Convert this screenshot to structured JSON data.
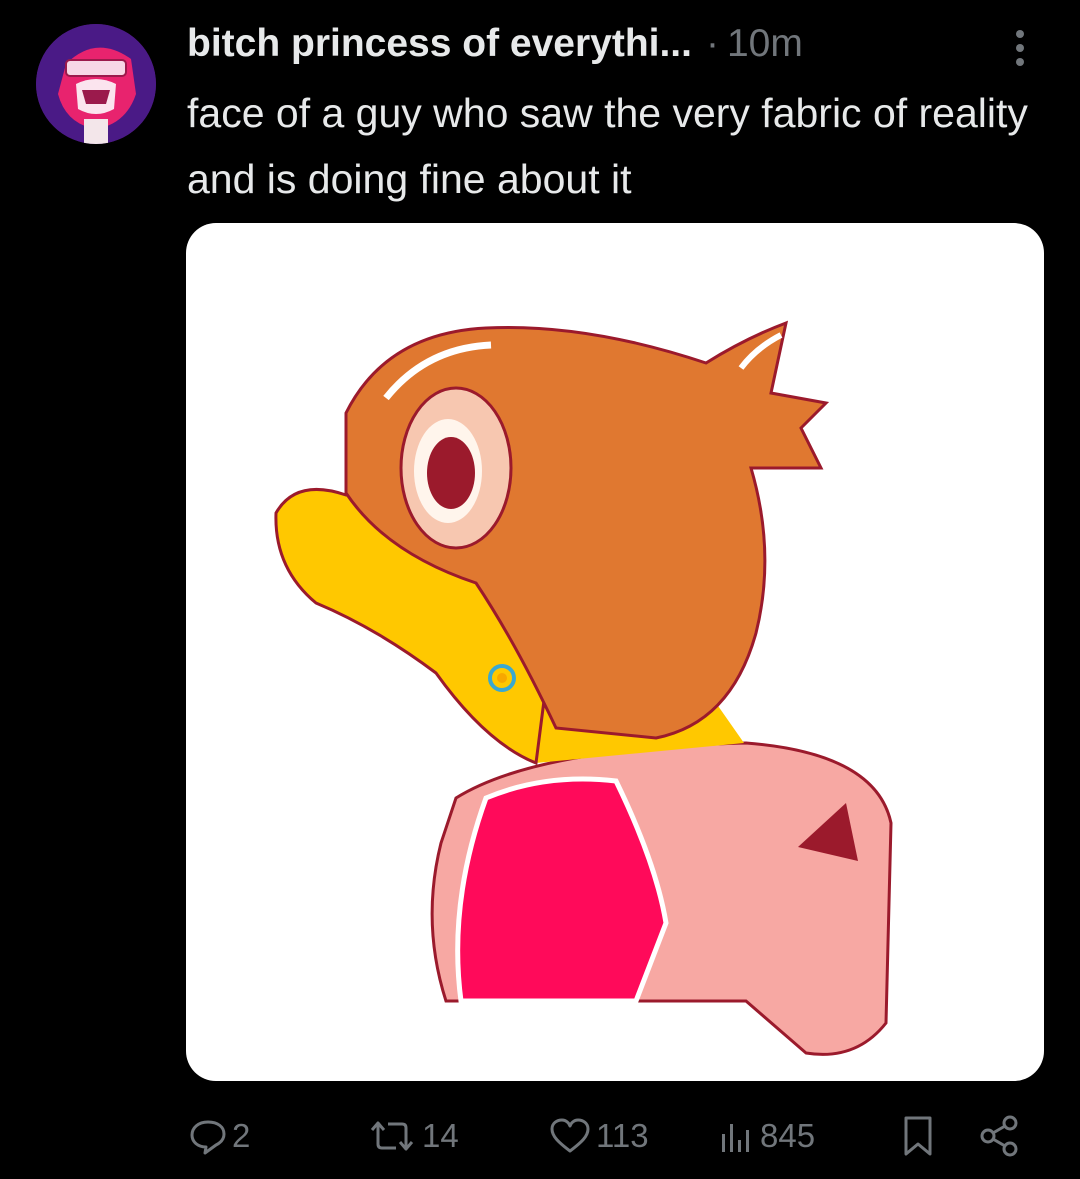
{
  "post": {
    "author_name": "bitch princess of everythi...",
    "separator": "·",
    "time": "10m",
    "text": "face of a guy who saw the very fabric of reality and is doing fine about it"
  },
  "actions": {
    "replies": "2",
    "reposts": "14",
    "likes": "113",
    "views": "845"
  },
  "colors": {
    "background": "#000000",
    "text": "#e7e9ea",
    "muted": "#71767b"
  }
}
